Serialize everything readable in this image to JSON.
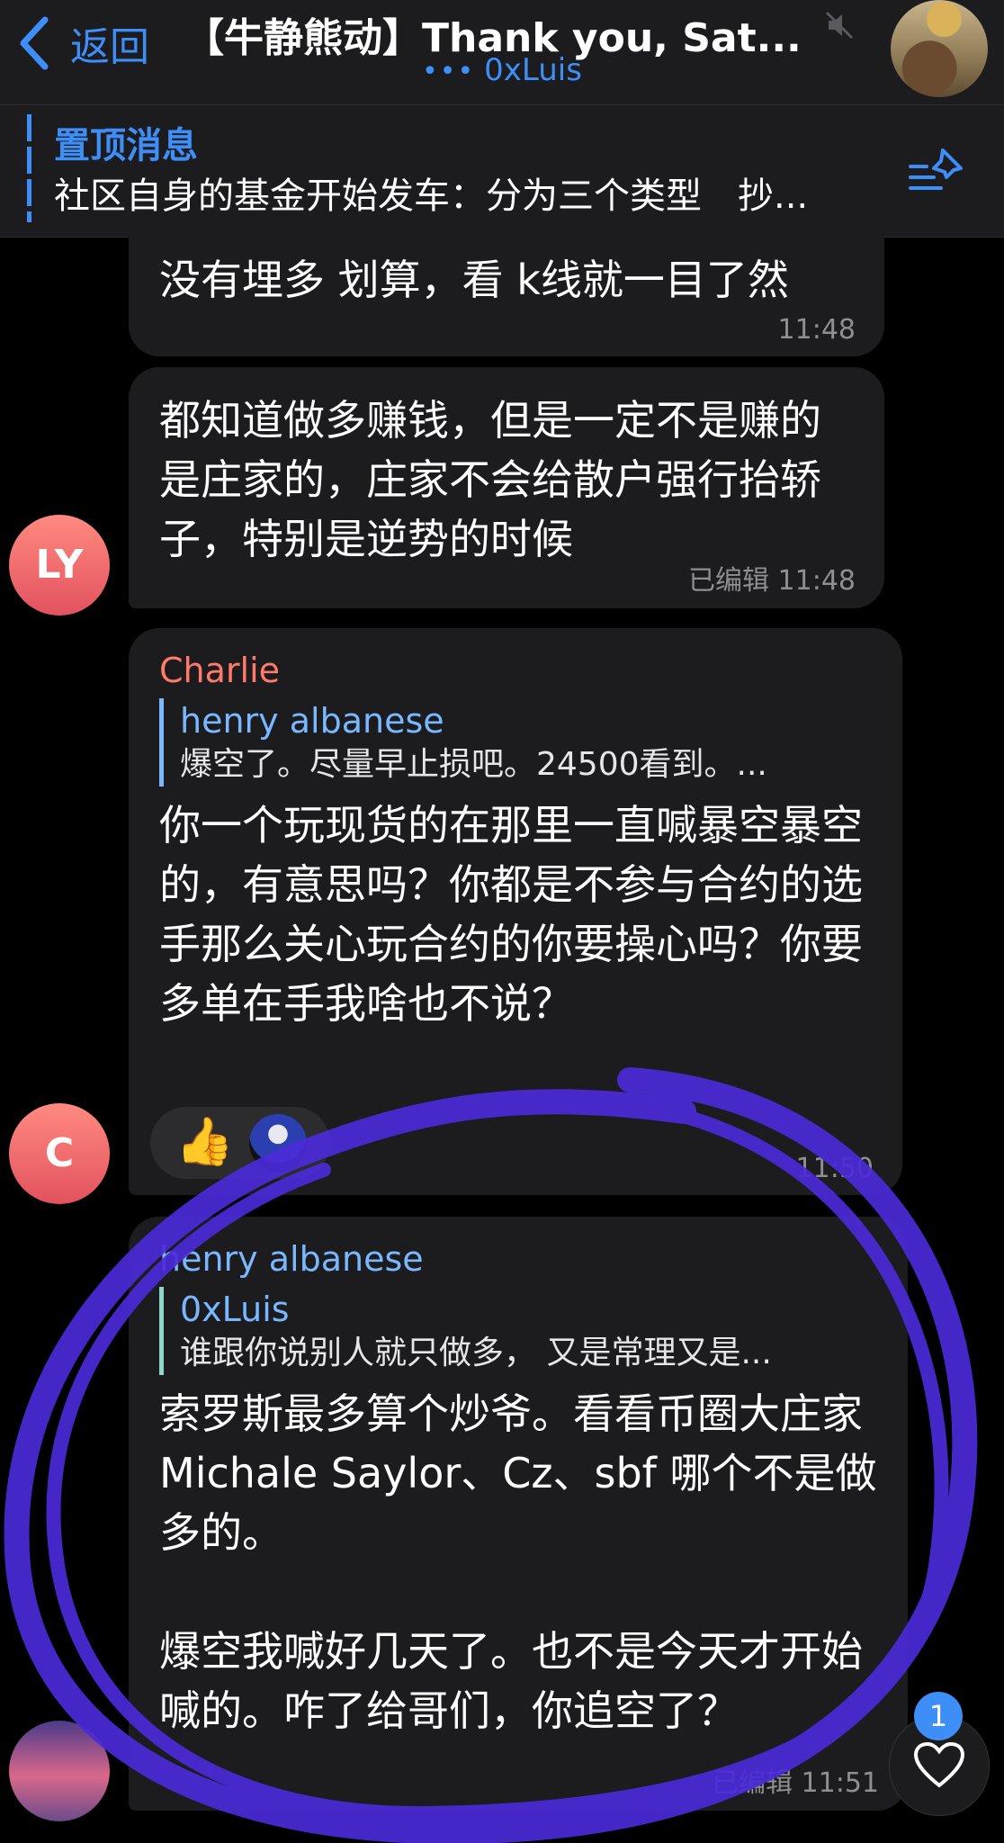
{
  "header": {
    "back_label": "返回",
    "title": "【牛静熊动】Thank you, Sat...",
    "subtitle": "0xLuis"
  },
  "pinned": {
    "label": "置顶消息",
    "text": "社区自身的基金开始发车：分为三个类型　抄..."
  },
  "messages": [
    {
      "text": "没有埋多 划算，看 k线就一目了然",
      "time": "11:48"
    },
    {
      "text": "都知道做多赚钱，但是一定不是赚的是庄家的，庄家不会给散户强行抬轿子，特别是逆势的时候",
      "time": "已编辑 11:48",
      "avatar": "LY"
    },
    {
      "sender": "Charlie",
      "reply_name": "henry albanese",
      "reply_text": "爆空了。尽量早止损吧。24500看到。...",
      "text": "你一个玩现货的在那里一直喊暴空暴空的，有意思吗？你都是不参与合约的选手那么关心玩合约的你要操心吗？你要多单在手我啥也不说？",
      "time": "11:50",
      "avatar": "C"
    },
    {
      "sender": "henry albanese",
      "reply_name": "0xLuis",
      "reply_text": "谁跟你说别人就只做多，  又是常理又是...",
      "text": "索罗斯最多算个炒爷。看看币圈大庄家 Michale Saylor、Cz、sbf 哪个不是做多的。\n\n爆空我喊好几天了。也不是今天才开始喊的。咋了给哥们，你追空了？",
      "time": "已编辑 11:51"
    }
  ],
  "fab": {
    "badge": "1"
  },
  "colors": {
    "accent": "#3e8ef7",
    "charlie": "#ff7a6b",
    "henry": "#79b8ff",
    "reply_bar": "#8fd7c8",
    "scribble": "#4b2bd8"
  }
}
